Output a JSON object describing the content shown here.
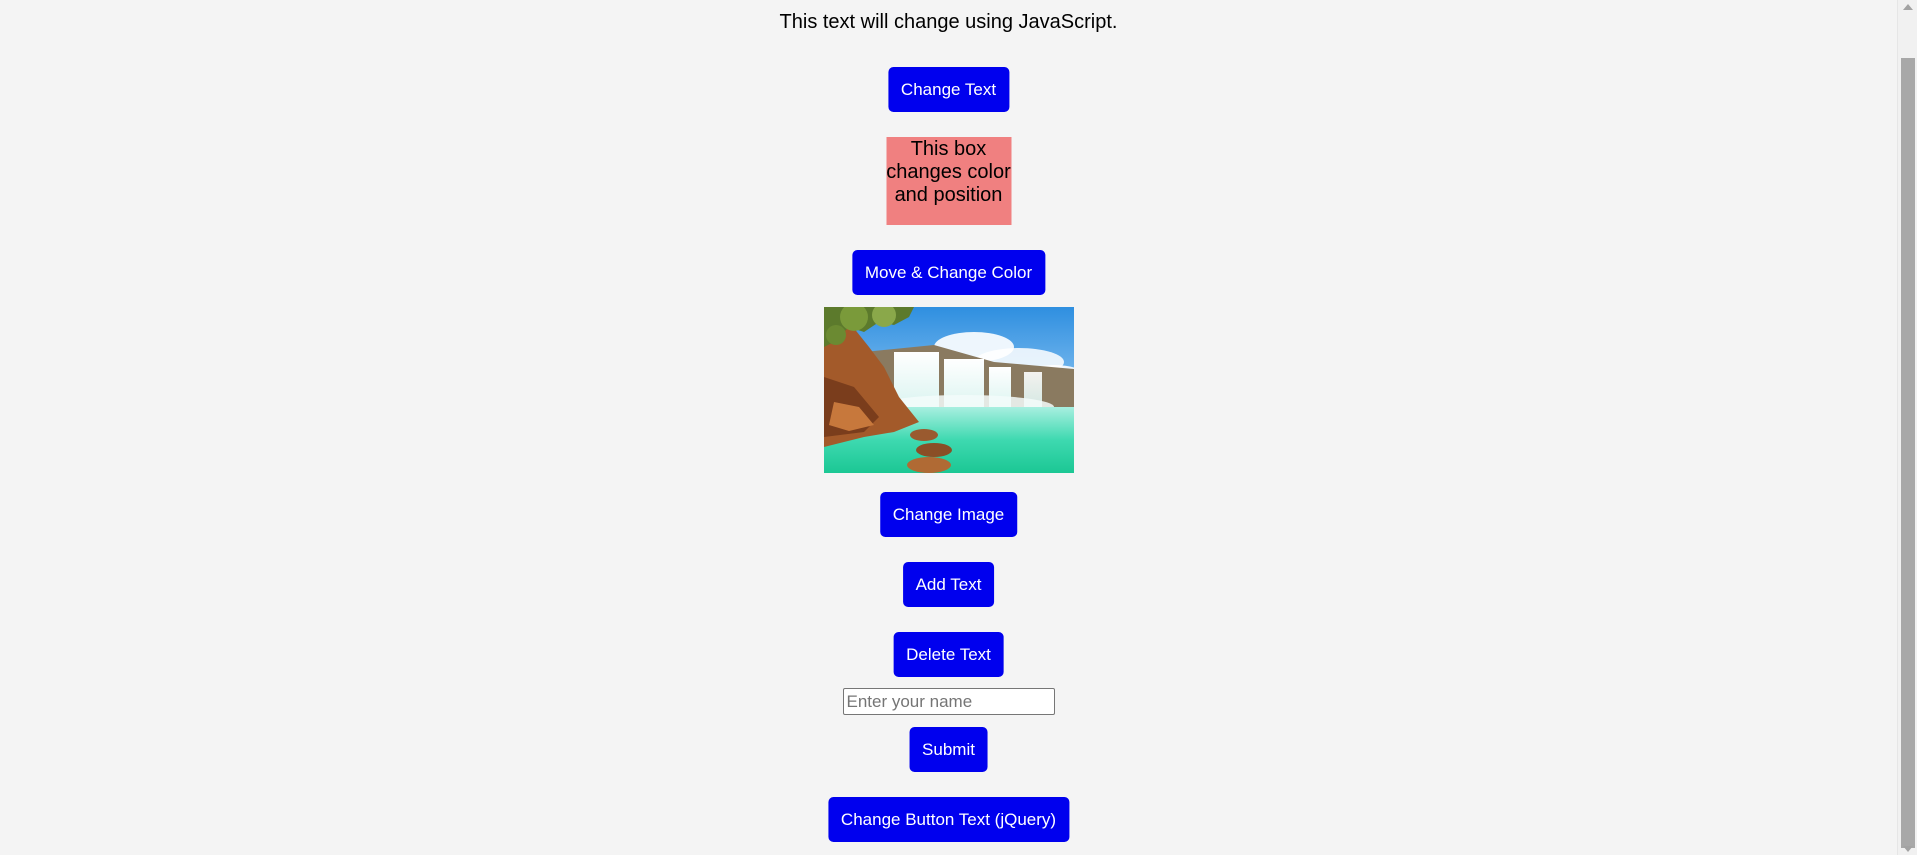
{
  "headline": "This text will change using JavaScript.",
  "buttons": {
    "change_text": "Change Text",
    "move_change_color": "Move & Change Color",
    "change_image": "Change Image",
    "add_text": "Add Text",
    "delete_text": "Delete Text",
    "submit": "Submit",
    "change_button_text_jquery": "Change Button Text (jQuery)"
  },
  "color_box": {
    "text": "This box changes color and position",
    "color": "#f08080"
  },
  "image": {
    "subject": "waterfall-landscape"
  },
  "name_input": {
    "placeholder": "Enter your name",
    "value": ""
  },
  "colors": {
    "button_bg": "#0000ee",
    "button_text": "#ffffff",
    "page_bg": "#f4f4f4"
  }
}
